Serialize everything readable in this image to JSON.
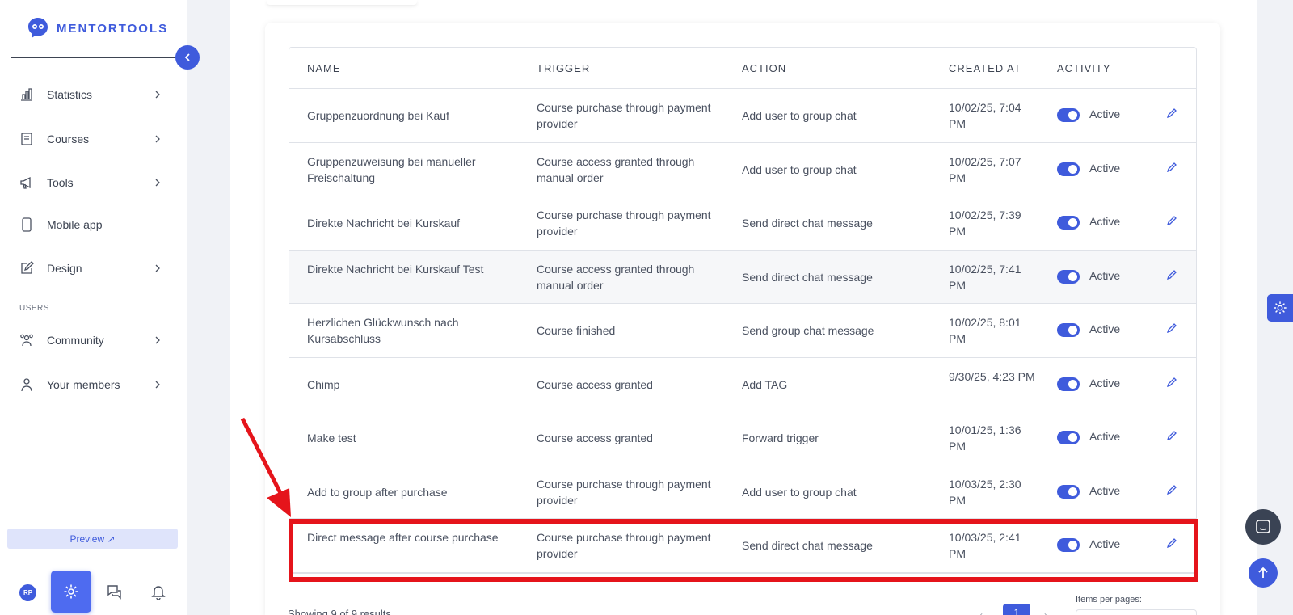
{
  "app": {
    "brand": "MENTORTOOLS"
  },
  "sidebar": {
    "items": [
      {
        "label": "Statistics",
        "icon": "bar-chart-icon",
        "has_chevron": true
      },
      {
        "label": "Courses",
        "icon": "book-icon",
        "has_chevron": true
      },
      {
        "label": "Tools",
        "icon": "megaphone-icon",
        "has_chevron": true
      },
      {
        "label": "Mobile app",
        "icon": "phone-icon",
        "has_chevron": false
      },
      {
        "label": "Design",
        "icon": "pencil-square-icon",
        "has_chevron": true
      },
      {
        "label": "Community",
        "icon": "users-icon",
        "has_chevron": true
      },
      {
        "label": "Your members",
        "icon": "user-icon",
        "has_chevron": true
      }
    ],
    "section_users": "USERS",
    "preview_label": "Preview ↗",
    "avatar_initials": "RP"
  },
  "table": {
    "headers": {
      "name": "NAME",
      "trigger": "TRIGGER",
      "action": "ACTION",
      "created_at": "CREATED AT",
      "activity": "ACTIVITY"
    },
    "rows": [
      {
        "name": "Gruppenzuordnung bei Kauf",
        "trigger": "Course purchase through payment provider",
        "action": "Add user to group chat",
        "created": "10/02/25, 7:04 PM",
        "status": "Active"
      },
      {
        "name": "Gruppenzuweisung bei manueller Freischaltung",
        "trigger": "Course access granted through manual order",
        "action": "Add user to group chat",
        "created": "10/02/25, 7:07 PM",
        "status": "Active"
      },
      {
        "name": "Direkte Nachricht bei Kurskauf",
        "trigger": "Course purchase through payment provider",
        "action": "Send direct chat message",
        "created": "10/02/25, 7:39 PM",
        "status": "Active"
      },
      {
        "name": "Direkte Nachricht bei Kurskauf Test",
        "trigger": "Course access granted through manual order",
        "action": "Send direct chat message",
        "created": "10/02/25, 7:41 PM",
        "status": "Active"
      },
      {
        "name": "Herzlichen Glückwunsch nach Kursabschluss",
        "trigger": "Course finished",
        "action": "Send group chat message",
        "created": "10/02/25, 8:01 PM",
        "status": "Active"
      },
      {
        "name": "Chimp",
        "trigger": "Course access granted",
        "action": "Add TAG",
        "created": "9/30/25, 4:23 PM",
        "status": "Active"
      },
      {
        "name": "Make test",
        "trigger": "Course access granted",
        "action": "Forward trigger",
        "created": "10/01/25, 1:36 PM",
        "status": "Active"
      },
      {
        "name": "Add to group after purchase",
        "trigger": "Course purchase through payment provider",
        "action": "Add user to group chat",
        "created": "10/03/25, 2:30 PM",
        "status": "Active"
      },
      {
        "name": "Direct message after course purchase",
        "trigger": "Course purchase through payment provider",
        "action": "Send direct chat message",
        "created": "10/03/25, 2:41 PM",
        "status": "Active"
      }
    ]
  },
  "footer": {
    "showing": "Showing 9 of 9 results",
    "items_per_page_label": "Items per pages:",
    "current_page": "1",
    "prev": "‹",
    "next": "›"
  },
  "colors": {
    "accent": "#3f5bdc",
    "highlight": "#e5141b"
  }
}
